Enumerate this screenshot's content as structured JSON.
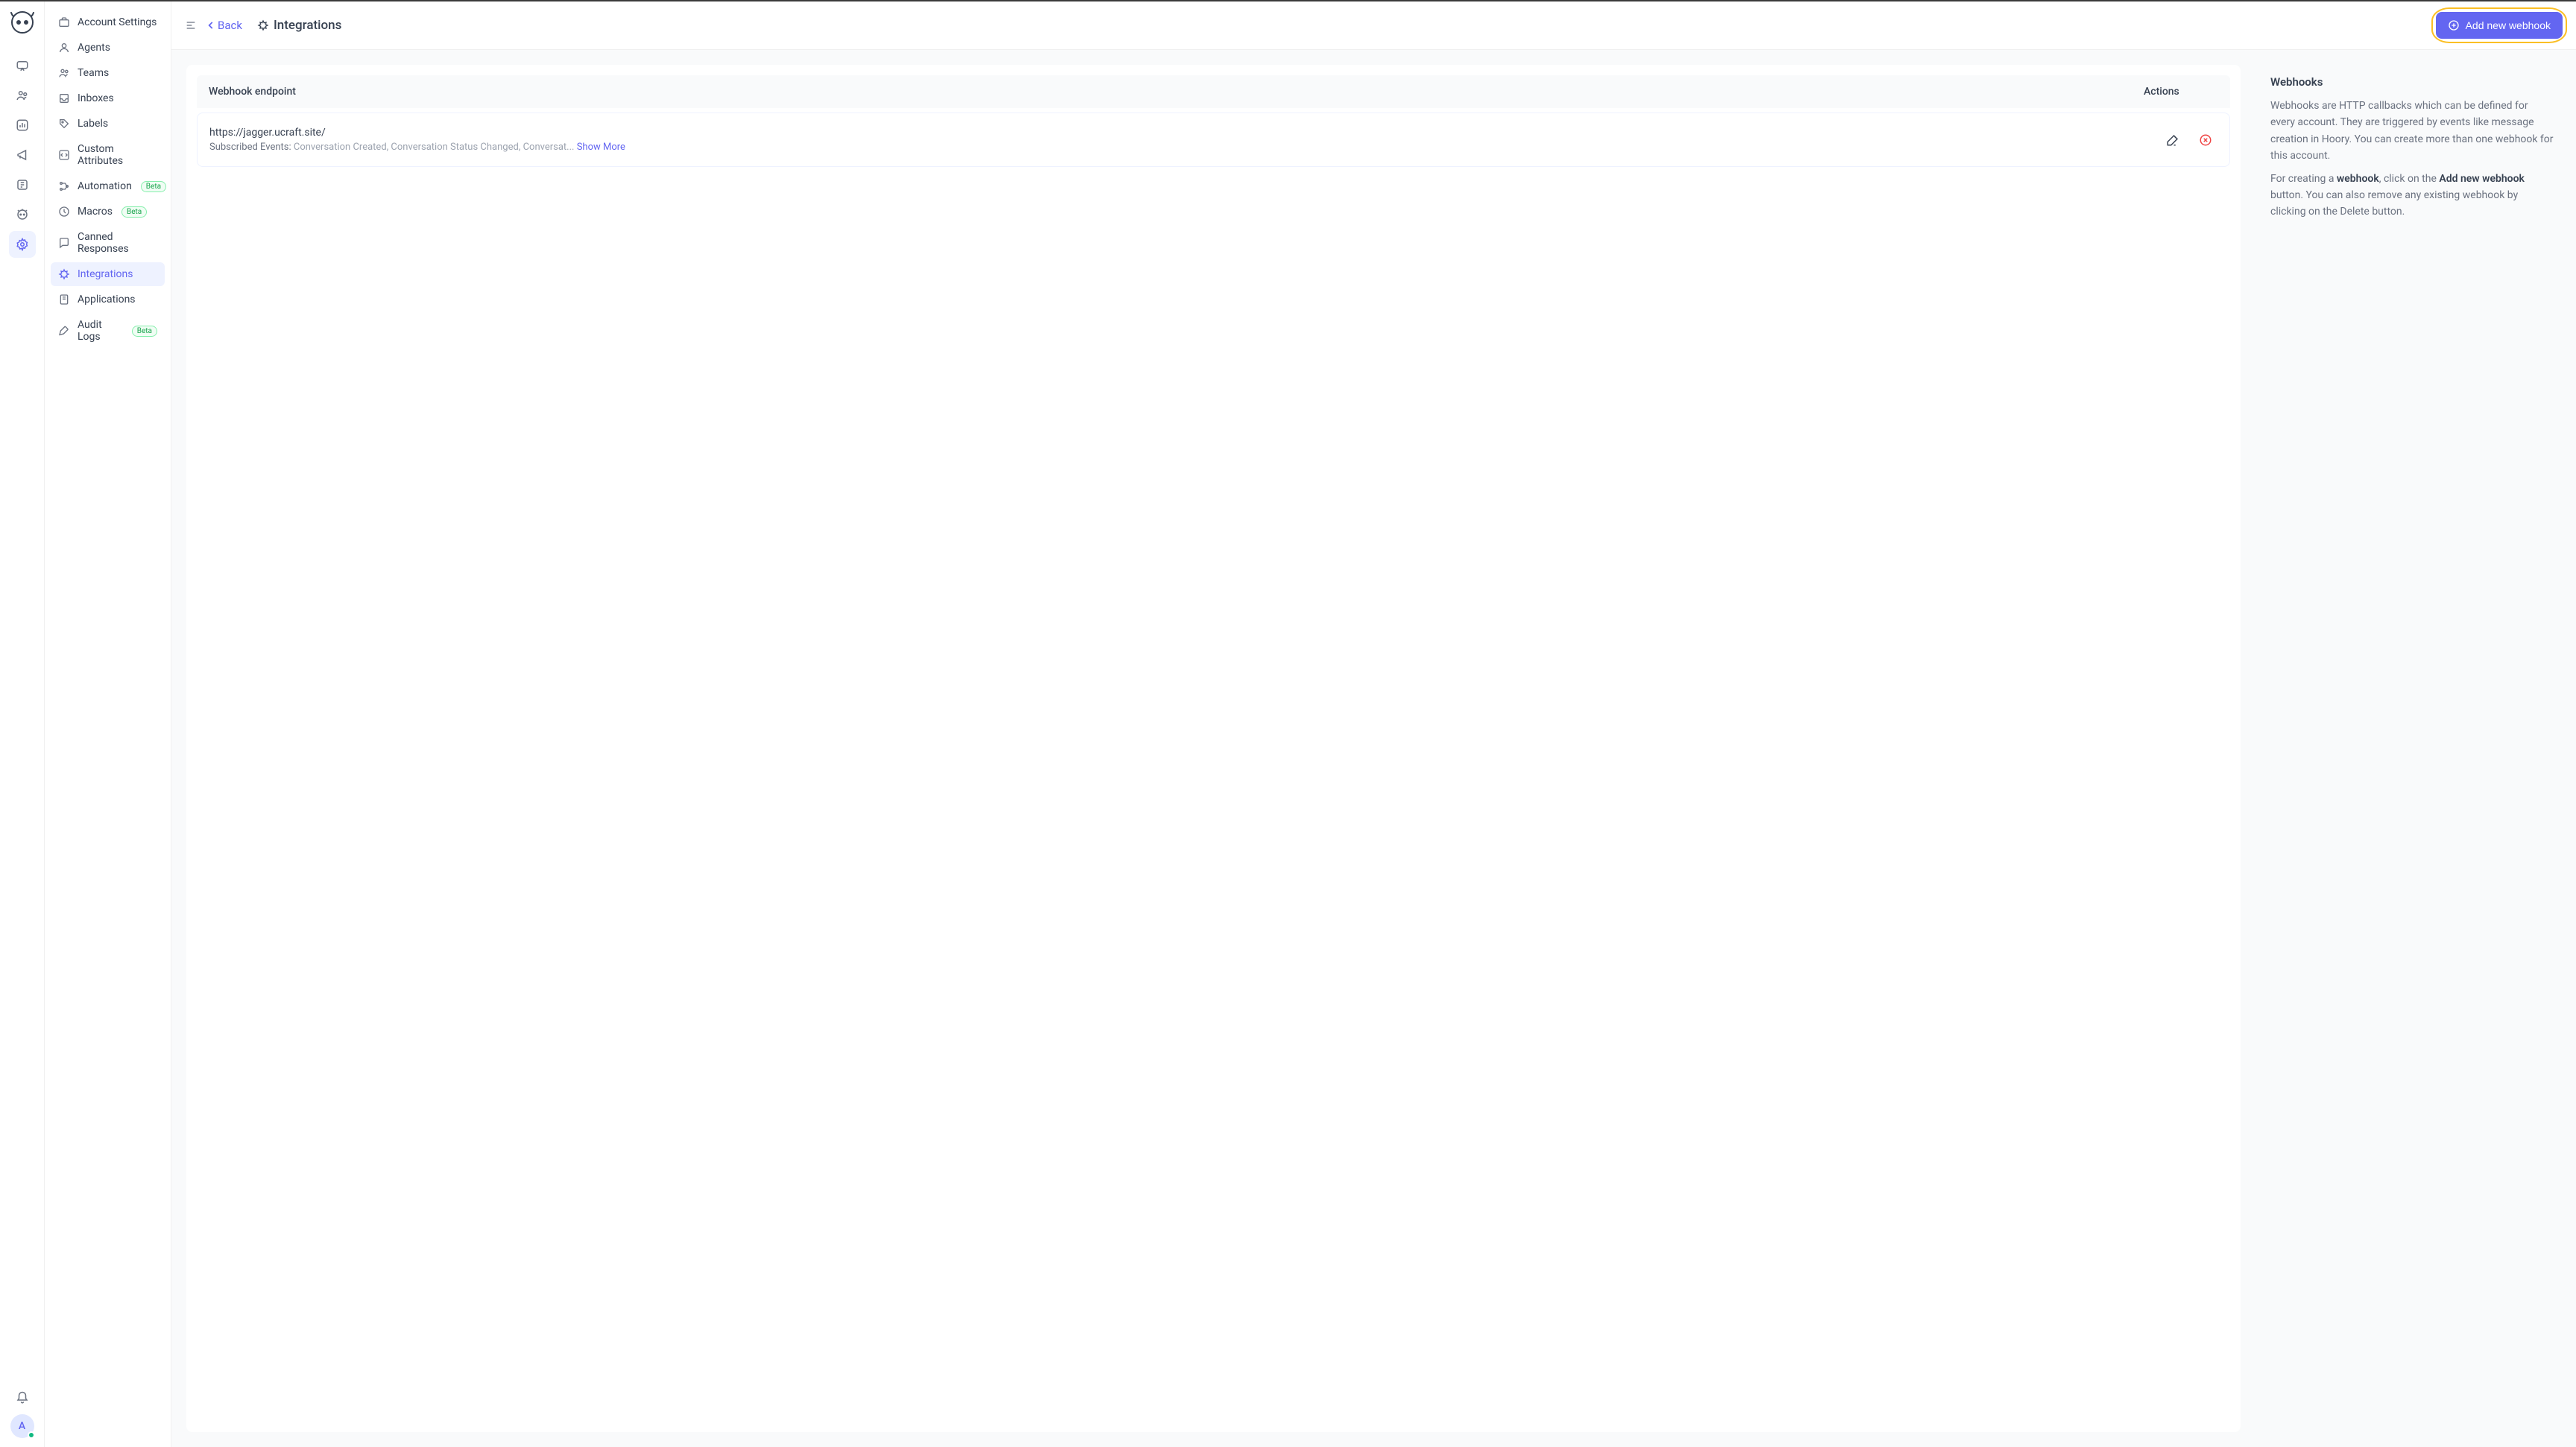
{
  "rail": {
    "avatar_initial": "A"
  },
  "sidebar": {
    "items": [
      {
        "label": "Account Settings"
      },
      {
        "label": "Agents"
      },
      {
        "label": "Teams"
      },
      {
        "label": "Inboxes"
      },
      {
        "label": "Labels"
      },
      {
        "label": "Custom Attributes"
      },
      {
        "label": "Automation",
        "beta": "Beta"
      },
      {
        "label": "Macros",
        "beta": "Beta"
      },
      {
        "label": "Canned Responses"
      },
      {
        "label": "Integrations"
      },
      {
        "label": "Applications"
      },
      {
        "label": "Audit Logs",
        "beta": "Beta"
      }
    ]
  },
  "header": {
    "back": "Back",
    "title": "Integrations",
    "add_button": "Add new webhook"
  },
  "table": {
    "col_endpoint": "Webhook endpoint",
    "col_actions": "Actions",
    "rows": [
      {
        "url": "https://jagger.ucraft.site/",
        "events_label": "Subscribed Events: ",
        "events_preview": "Conversation Created, Conversation Status Changed, Conversat... ",
        "show_more": "Show More"
      }
    ]
  },
  "info": {
    "title": "Webhooks",
    "p1": "Webhooks are HTTP callbacks which can be defined for every account. They are triggered by events like message creation in Hoory. You can create more than one webhook for this account.",
    "p2_pre": "For creating a ",
    "p2_b1": "webhook",
    "p2_mid": ", click on the ",
    "p2_b2": "Add new webhook",
    "p2_post": " button. You can also remove any existing webhook by clicking on the Delete button."
  }
}
